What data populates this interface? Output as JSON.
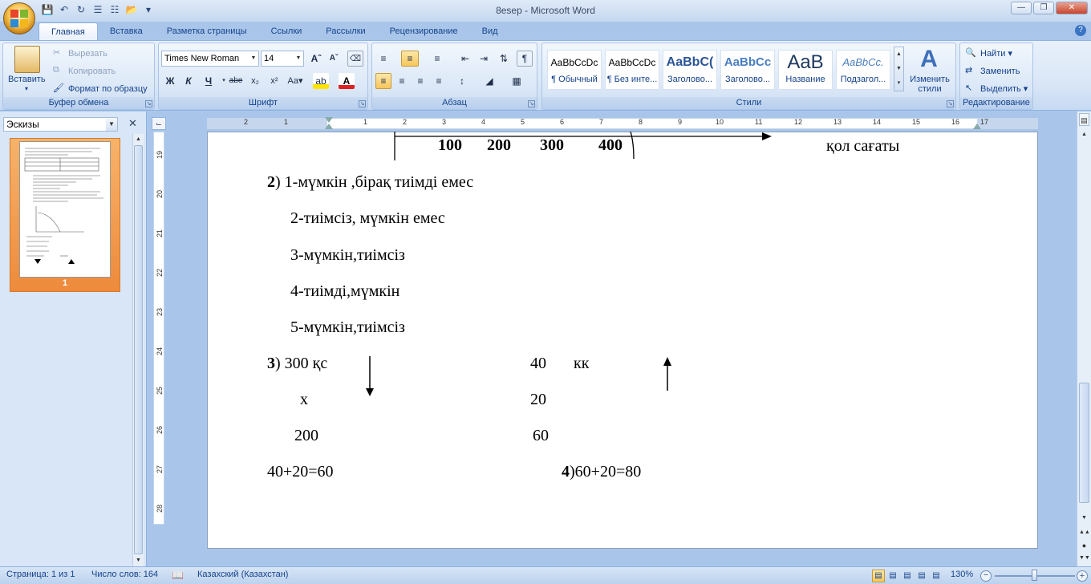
{
  "window": {
    "title": "8esep - Microsoft Word"
  },
  "quick_access": [
    "save-icon",
    "undo-icon",
    "redo-icon",
    "list-icon",
    "list2-icon",
    "open-icon",
    "more-icon"
  ],
  "tabs": [
    "Главная",
    "Вставка",
    "Разметка страницы",
    "Ссылки",
    "Рассылки",
    "Рецензирование",
    "Вид"
  ],
  "ribbon": {
    "clipboard": {
      "label": "Буфер обмена",
      "paste": "Вставить",
      "cut": "Вырезать",
      "copy": "Копировать",
      "format_painter": "Формат по образцу"
    },
    "font": {
      "label": "Шрифт",
      "font_name": "Times New Roman",
      "font_size": "14"
    },
    "paragraph": {
      "label": "Абзац"
    },
    "styles": {
      "label": "Стили",
      "items": [
        {
          "sample": "AaBbCcDc",
          "name": "¶ Обычный"
        },
        {
          "sample": "AaBbCcDc",
          "name": "¶ Без инте..."
        },
        {
          "sample": "AaBbC(",
          "name": "Заголово..."
        },
        {
          "sample": "AaBbCc",
          "name": "Заголово..."
        },
        {
          "sample": "AaB",
          "name": "Название"
        },
        {
          "sample": "AaBbCc.",
          "name": "Подзагол..."
        }
      ],
      "change": "Изменить стили"
    },
    "editing": {
      "label": "Редактирование",
      "find": "Найти",
      "replace": "Заменить",
      "select": "Выделить"
    }
  },
  "nav": {
    "mode": "Эскизы",
    "page_number": "1"
  },
  "ruler": {
    "h_numbers": [
      "2",
      "1",
      "1",
      "1",
      "2",
      "3",
      "4",
      "5",
      "6",
      "7",
      "8",
      "9",
      "10",
      "11",
      "12",
      "13",
      "14",
      "15",
      "16",
      "17"
    ],
    "v_numbers": [
      "19",
      "20",
      "21",
      "22",
      "23",
      "24",
      "25",
      "26",
      "27",
      "28"
    ]
  },
  "document": {
    "axis_labels": [
      "100",
      "200",
      "300",
      "400"
    ],
    "axis_caption": "қол сағаты",
    "p2_num": "2",
    "p2_line1": ") 1-мүмкін ,бірақ тиімді емес",
    "p2_line2": "2-тиімсіз, мүмкін емес",
    "p2_line3": "3-мүмкін,тиімсіз",
    "p2_line4": "4-тиімді,мүмкін",
    "p2_line5": "5-мүмкін,тиімсіз",
    "p3_num": "3",
    "p3_a": ") 300  қс",
    "p3_b": "х",
    "p3_c": "200",
    "p3_right_a": "40",
    "p3_right_a2": "кк",
    "p3_right_b": "20",
    "p3_right_c": "60",
    "sum_left": "40+20=60",
    "p4_num": "4",
    "sum_right": ")60+20=80"
  },
  "status": {
    "page": "Страница: 1 из 1",
    "words": "Число слов: 164",
    "language": "Казахский (Казахстан)",
    "zoom": "130%"
  }
}
